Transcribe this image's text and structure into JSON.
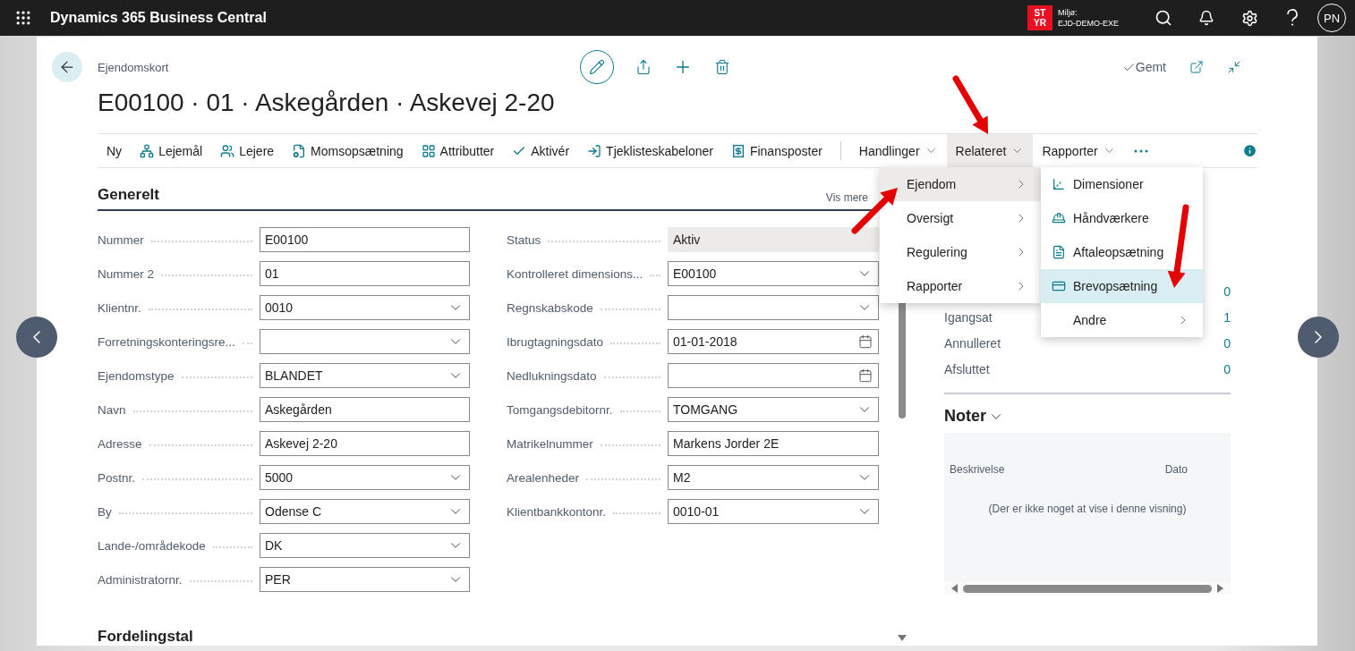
{
  "topbar": {
    "app_title": "Dynamics 365 Business Central",
    "environment_badge": "ST YR",
    "environment_label": "Miljø:",
    "environment_name": "EJD-DEMO-EXE",
    "avatar": "PN"
  },
  "header": {
    "breadcrumb": "Ejendomskort",
    "saved": "Gemt",
    "title": "E00100 · 01 · Askegården · Askevej 2-20"
  },
  "actions": [
    {
      "label": "Ny",
      "kind": "action",
      "selected": false
    },
    {
      "label": "Lejemål",
      "kind": "action",
      "selected": false
    },
    {
      "label": "Lejere",
      "kind": "action",
      "selected": false
    },
    {
      "label": "Momsopsætning",
      "kind": "action",
      "selected": false
    },
    {
      "label": "Attributter",
      "kind": "action",
      "selected": false
    },
    {
      "label": "Aktivér",
      "kind": "action",
      "selected": false
    },
    {
      "label": "Tjeklisteskabeloner",
      "kind": "action",
      "selected": false
    },
    {
      "label": "Finansposter",
      "kind": "action",
      "selected": false
    },
    {
      "label": "Handlinger",
      "kind": "menu",
      "selected": false
    },
    {
      "label": "Relateret",
      "kind": "menu",
      "selected": true
    },
    {
      "label": "Rapporter",
      "kind": "menu",
      "selected": false
    }
  ],
  "section": {
    "title": "Generelt",
    "show_more": "Vis mere"
  },
  "fields_left": [
    {
      "label": "Nummer",
      "value": "E00100",
      "kind": "text"
    },
    {
      "label": "Nummer 2",
      "value": "01",
      "kind": "text"
    },
    {
      "label": "Klientnr.",
      "value": "0010",
      "kind": "dropdown"
    },
    {
      "label": "Forretningskonteringsre...",
      "kind": "dropdown"
    },
    {
      "label": "Ejendomstype",
      "value": "BLANDET",
      "kind": "dropdown"
    },
    {
      "label": "Navn",
      "value": "Askegården",
      "kind": "text"
    },
    {
      "label": "Adresse",
      "value": "Askevej 2-20",
      "kind": "text"
    },
    {
      "label": "Postnr.",
      "value": "5000",
      "kind": "dropdown"
    },
    {
      "label": "By",
      "value": "Odense C",
      "kind": "dropdown"
    },
    {
      "label": "Lande-/områdekode",
      "value": "DK",
      "kind": "dropdown"
    },
    {
      "label": "Administratornr.",
      "value": "PER",
      "kind": "dropdown"
    }
  ],
  "fields_right": [
    {
      "label": "Status",
      "value": "Aktiv",
      "kind": "readonly"
    },
    {
      "label": "Kontrolleret dimensions...",
      "value": "E00100",
      "kind": "dropdown"
    },
    {
      "label": "Regnskabskode",
      "kind": "dropdown"
    },
    {
      "label": "Ibrugtagningsdato",
      "value": "01-01-2018",
      "kind": "date"
    },
    {
      "label": "Nedlukningsdato",
      "kind": "date"
    },
    {
      "label": "Tomgangsdebitornr.",
      "value": "TOMGANG",
      "kind": "dropdown"
    },
    {
      "label": "Matrikelnummer",
      "value": "Markens Jorder 2E",
      "kind": "text"
    },
    {
      "label": "Arealenheder",
      "value": "M2",
      "kind": "dropdown"
    },
    {
      "label": "Klientbankkontonr.",
      "value": "0010-01",
      "kind": "dropdown"
    }
  ],
  "next_section": "Fordelingstal",
  "factbox": {
    "rows": [
      {
        "value": "0"
      },
      {
        "label": "Igangsat",
        "value": "1"
      },
      {
        "label": "Annulleret",
        "value": "0"
      },
      {
        "label": "Afsluttet",
        "value": "0"
      }
    ],
    "notes": {
      "title": "Noter",
      "columns": [
        "Beskrivelse",
        "Dato"
      ],
      "empty_message": "(Der er ikke noget at vise i denne visning)"
    }
  },
  "related_menu": [
    {
      "label": "Ejendom",
      "kind": "submenu",
      "selected": true
    },
    {
      "label": "Oversigt",
      "kind": "submenu",
      "selected": false
    },
    {
      "label": "Regulering",
      "kind": "submenu",
      "selected": false
    },
    {
      "label": "Rapporter",
      "kind": "submenu",
      "selected": false
    }
  ],
  "property_menu": [
    {
      "label": "Dimensioner",
      "kind": "action",
      "selected": false
    },
    {
      "label": "Håndværkere",
      "kind": "action",
      "selected": false
    },
    {
      "label": "Aftaleopsætning",
      "kind": "action",
      "selected": false
    },
    {
      "label": "Brevopsætning",
      "kind": "action",
      "selected": true
    },
    {
      "label": "Andre",
      "kind": "submenu",
      "selected": false
    }
  ]
}
